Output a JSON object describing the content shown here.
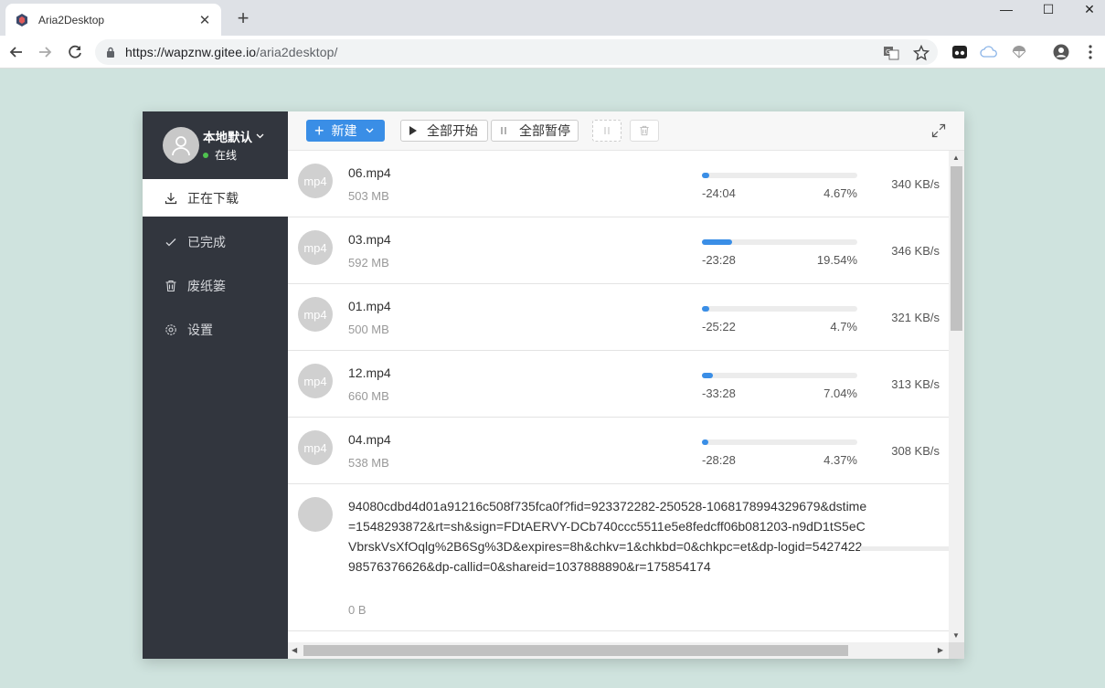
{
  "browser": {
    "tab_title": "Aria2Desktop",
    "tab_close": "✕",
    "new_tab": "+",
    "url_host": "https://wapznw.gitee.io",
    "url_path": "/aria2desktop/",
    "min": "—",
    "max": "☐",
    "close": "✕"
  },
  "sidebar": {
    "user_name": "本地默认",
    "user_status": "在线",
    "items": [
      {
        "label": "正在下载",
        "active": true
      },
      {
        "label": "已完成"
      },
      {
        "label": "废纸篓"
      },
      {
        "label": "设置"
      }
    ]
  },
  "toolbar": {
    "new_label": "新建",
    "start_all_label": "全部开始",
    "pause_all_label": "全部暂停"
  },
  "downloads": [
    {
      "type": "mp4",
      "name": "06.mp4",
      "size": "503 MB",
      "remaining": "-24:04",
      "percent_text": "4.67%",
      "progress": 0.0467,
      "speed": "340 KB/s"
    },
    {
      "type": "mp4",
      "name": "03.mp4",
      "size": "592 MB",
      "remaining": "-23:28",
      "percent_text": "19.54%",
      "progress": 0.1954,
      "speed": "346 KB/s"
    },
    {
      "type": "mp4",
      "name": "01.mp4",
      "size": "500 MB",
      "remaining": "-25:22",
      "percent_text": "4.7%",
      "progress": 0.047,
      "speed": "321 KB/s"
    },
    {
      "type": "mp4",
      "name": "12.mp4",
      "size": "660 MB",
      "remaining": "-33:28",
      "percent_text": "7.04%",
      "progress": 0.0704,
      "speed": "313 KB/s"
    },
    {
      "type": "mp4",
      "name": "04.mp4",
      "size": "538 MB",
      "remaining": "-28:28",
      "percent_text": "4.37%",
      "progress": 0.0437,
      "speed": "308 KB/s"
    }
  ],
  "pending": {
    "name": "94080cdbd4d01a91216c508f735fca0f?fid=923372282-250528-1068178994329679&dstime=1548293872&rt=sh&sign=FDtAERVY-DCb740ccc5511e5e8fedcff06b081203-n9dD1tS5eCVbrskVsXfOqlg%2B6Sg%3D&expires=8h&chkv=1&chkbd=0&chkpc=et&dp-logid=542742298576376626&dp-callid=0&shareid=1037888890&r=175854174",
    "size": "0 B"
  }
}
